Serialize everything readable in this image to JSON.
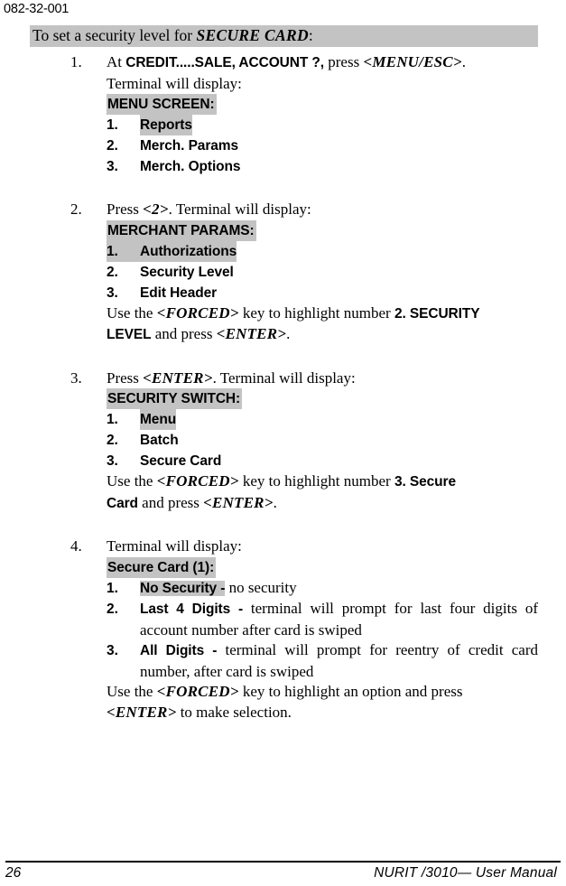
{
  "header": {
    "doc_number": "082-32-001"
  },
  "title": {
    "prefix": "To set a security level for ",
    "product": "SECURE CARD",
    "suffix": ":"
  },
  "steps": [
    {
      "number": "1.",
      "line1_a": "At ",
      "line1_b": "CREDIT.....SALE, ACCOUNT ?,",
      "line1_c": " press ",
      "line1_d": "<MENU/ESC>",
      "line1_e": ".",
      "line2": "Terminal will display:",
      "screen": {
        "title": "MENU SCREEN:",
        "title_highlighted": true,
        "rows": [
          {
            "num": "1.",
            "label": "Reports",
            "highlight": "label"
          },
          {
            "num": "2.",
            "label": "Merch. Params",
            "highlight": "none"
          },
          {
            "num": "3.",
            "label": "Merch. Options",
            "highlight": "none"
          }
        ]
      }
    },
    {
      "number": "2.",
      "line1_a": "Press ",
      "line1_b": "<2>",
      "line1_c": ". Terminal will display:",
      "screen": {
        "title": "MERCHANT PARAMS:",
        "title_highlighted": true,
        "rows": [
          {
            "num": "1.",
            "label": "Authorizations",
            "highlight": "row"
          },
          {
            "num": "2.",
            "label": "Security Level",
            "highlight": "none"
          },
          {
            "num": "3.",
            "label": "Edit Header",
            "highlight": "none"
          }
        ]
      },
      "trailer": {
        "line1_a": "Use the ",
        "line1_b": "<FORCED>",
        "line1_c": " key to highlight number ",
        "line1_d": "2. SECURITY",
        "line2_a": "LEVEL",
        "line2_b": " and press ",
        "line2_c": "<ENTER>",
        "line2_d": "."
      }
    },
    {
      "number": "3.",
      "line1_a": "Press ",
      "line1_b": "<ENTER>",
      "line1_c": ". Terminal will display:",
      "screen": {
        "title": "SECURITY SWITCH:",
        "title_highlighted": true,
        "rows": [
          {
            "num": "1.",
            "label": "Menu",
            "highlight": "label"
          },
          {
            "num": "2.",
            "label": "Batch",
            "highlight": "none"
          },
          {
            "num": "3.",
            "label": "Secure Card",
            "highlight": "none"
          }
        ]
      },
      "trailer": {
        "line1_a": "Use the ",
        "line1_b": "<FORCED>",
        "line1_c": " key to highlight number ",
        "line1_d": "3. Secure",
        "line2_a": "Card",
        "line2_b": " and press ",
        "line2_c": "<ENTER>",
        "line2_d": "."
      }
    },
    {
      "number": "4.",
      "line1": "Terminal will display:",
      "screen": {
        "title": "Secure Card (1):",
        "title_highlighted": true
      },
      "options": [
        {
          "num": "1.",
          "label": "No Security -",
          "label_highlighted": true,
          "desc": " no security"
        },
        {
          "num": "2.",
          "label": "Last 4 Digits -",
          "label_highlighted": false,
          "desc": " terminal will prompt for last four digits of account number after card is swiped"
        },
        {
          "num": "3.",
          "label": "All Digits -",
          "label_highlighted": false,
          "desc": " terminal will prompt for reentry of credit card number, after card is swiped"
        }
      ],
      "trailer": {
        "line1_a": "Use the ",
        "line1_b": "<FORCED>",
        "line1_c": " key to highlight an option and press",
        "line2_a": "<ENTER>",
        "line2_b": " to make selection."
      }
    }
  ],
  "footer": {
    "page_number": "26",
    "manual": "NURIT /3010— User Manual"
  },
  "colors": {
    "highlight": "#c3c3c3",
    "text": "#000000",
    "background": "#ffffff"
  }
}
